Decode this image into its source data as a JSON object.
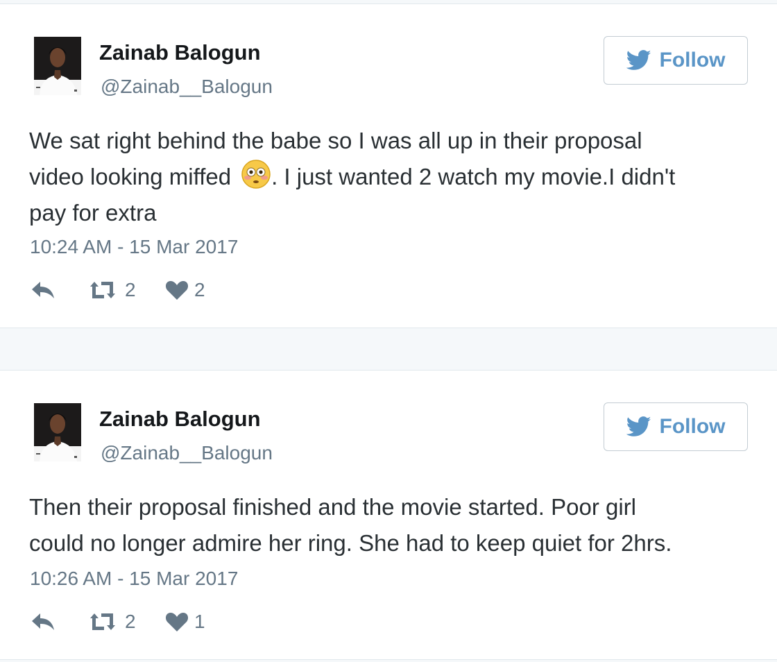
{
  "colors": {
    "action_icon": "#657786",
    "follow_blue": "#5a95c7",
    "text": "#292f33",
    "secondary_text": "#657786"
  },
  "tweets": [
    {
      "author": {
        "name": "Zainab Balogun",
        "handle": "@Zainab__Balogun"
      },
      "follow_label": "Follow",
      "text_lines": [
        "We sat right behind the babe so I was all up in their proposal",
        "video looking miffed",
        ". I just wanted 2 watch my movie.I didn't",
        "pay for extra"
      ],
      "emoji": "flushed-face",
      "timestamp": "10:24 AM - 15 Mar 2017",
      "retweets": "2",
      "likes": "2"
    },
    {
      "author": {
        "name": "Zainab Balogun",
        "handle": "@Zainab__Balogun"
      },
      "follow_label": "Follow",
      "text_lines": [
        "Then their proposal finished and the movie started. Poor girl",
        "could no longer admire her ring. She had to keep quiet for 2hrs."
      ],
      "timestamp": "10:26 AM - 15 Mar 2017",
      "retweets": "2",
      "likes": "1"
    }
  ]
}
